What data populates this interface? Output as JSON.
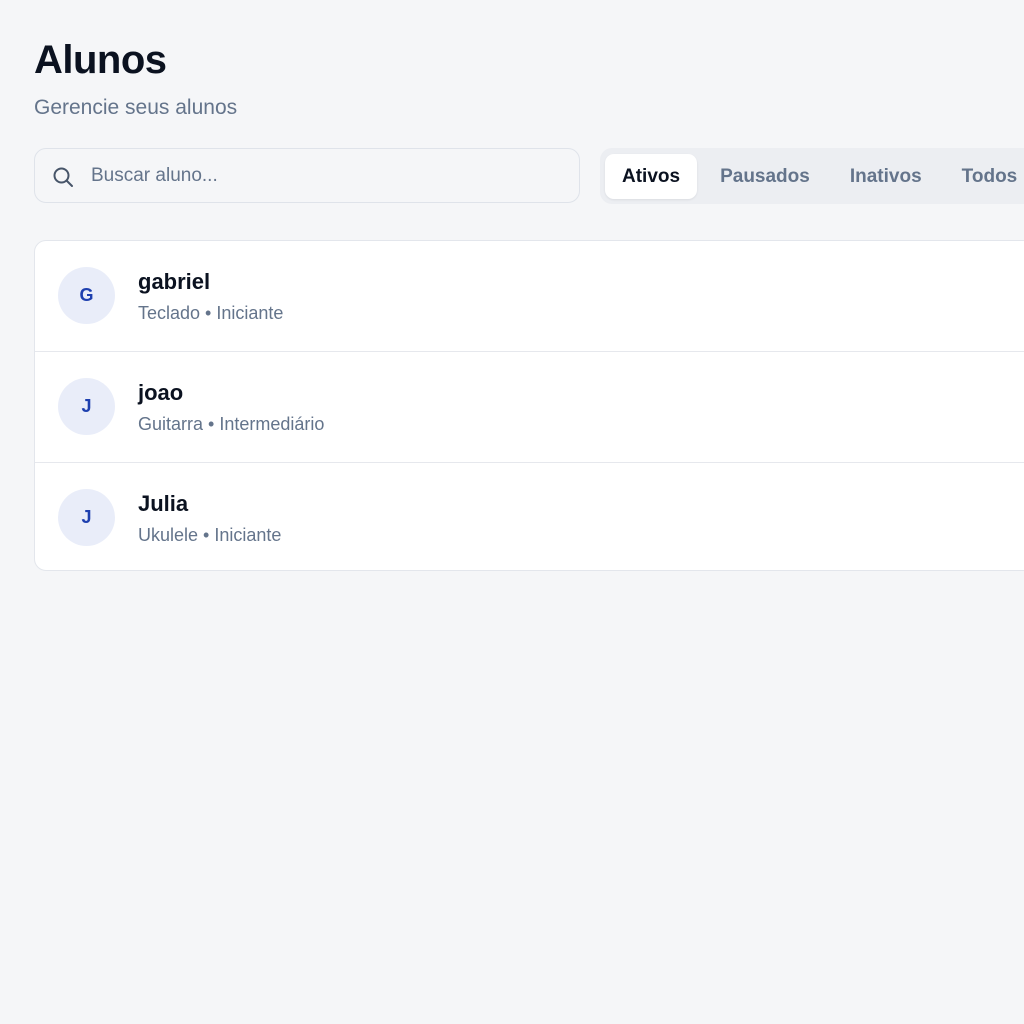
{
  "header": {
    "title": "Alunos",
    "subtitle": "Gerencie seus alunos"
  },
  "search": {
    "placeholder": "Buscar aluno...",
    "value": "",
    "icon": "search-icon"
  },
  "tabs": [
    {
      "label": "Ativos",
      "active": true
    },
    {
      "label": "Pausados",
      "active": false
    },
    {
      "label": "Inativos",
      "active": false
    },
    {
      "label": "Todos",
      "active": false
    }
  ],
  "students": [
    {
      "initial": "G",
      "name": "gabriel",
      "meta": "Teclado • Iniciante"
    },
    {
      "initial": "J",
      "name": "joao",
      "meta": "Guitarra • Intermediário"
    },
    {
      "initial": "J",
      "name": "Julia",
      "meta": "Ukulele • Iniciante"
    }
  ],
  "colors": {
    "background": "#f5f6f8",
    "avatar_bg": "#e9edf9",
    "avatar_text": "#1e40af",
    "muted_text": "#64748b"
  }
}
